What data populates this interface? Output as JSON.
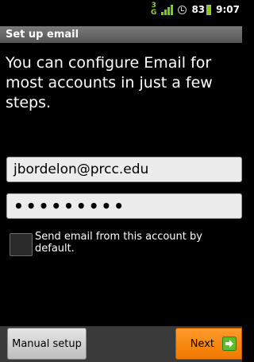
{
  "status_bar": {
    "network_type": "3G",
    "signal_icon": "signal-bars-icon",
    "alarm_icon": "alarm-clock-icon",
    "battery_level": "83",
    "time": "9:07"
  },
  "title": "Set up email",
  "intro_text": "You can configure Email for most accounts in just a few steps.",
  "form": {
    "email_value": "jbordelon@prcc.edu",
    "password_masked": "•••••••••"
  },
  "default_account_checkbox": {
    "label": "Send email from this account by default.",
    "checked": false
  },
  "buttons": {
    "manual_setup": "Manual setup",
    "next": "Next",
    "next_icon": "arrow-right-icon"
  },
  "colors": {
    "accent_next": "#f07800",
    "signal": "#7fd000"
  }
}
